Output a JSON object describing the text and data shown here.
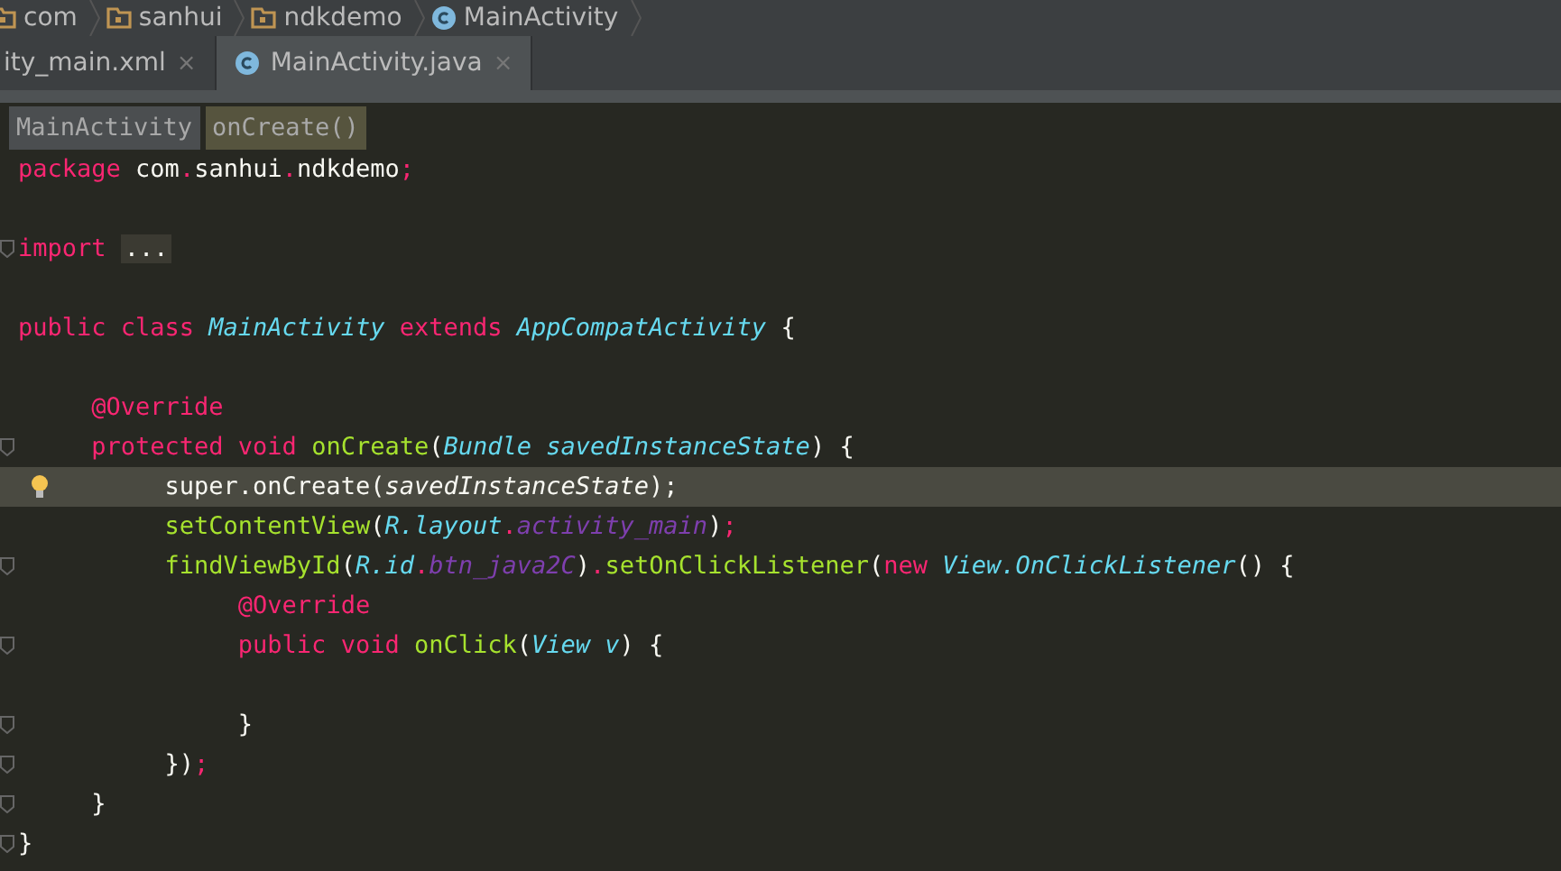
{
  "breadcrumbs": [
    {
      "kind": "folder",
      "label": "com"
    },
    {
      "kind": "folder",
      "label": "sanhui"
    },
    {
      "kind": "folder",
      "label": "ndkdemo"
    },
    {
      "kind": "class",
      "label": "MainActivity"
    }
  ],
  "tabs": [
    {
      "label": "ity_main.xml",
      "kind": "xml",
      "selected": false,
      "close": "×"
    },
    {
      "label": "MainActivity.java",
      "kind": "class",
      "selected": true,
      "close": "×"
    }
  ],
  "structure": [
    {
      "label": "MainActivity",
      "selected": false
    },
    {
      "label": "onCreate()",
      "selected": true
    }
  ],
  "lines": [
    {
      "tokens": [
        {
          "kind": "kw",
          "text": "package"
        },
        {
          "kind": "plain",
          "text": " com"
        },
        {
          "kind": "punct",
          "text": "."
        },
        {
          "kind": "plain",
          "text": "sanhui"
        },
        {
          "kind": "punct",
          "text": "."
        },
        {
          "kind": "plain",
          "text": "ndkdemo"
        },
        {
          "kind": "punct",
          "text": ";"
        }
      ]
    },
    {
      "kind": "blank"
    },
    {
      "fold": true,
      "tokens": [
        {
          "kind": "kw",
          "text": "import "
        },
        {
          "kind": "folded",
          "text": "..."
        }
      ]
    },
    {
      "kind": "blank"
    },
    {
      "tokens": [
        {
          "kind": "kw",
          "text": "public class "
        },
        {
          "kind": "type",
          "text": "MainActivity"
        },
        {
          "kind": "kw",
          "text": " extends "
        },
        {
          "kind": "type",
          "text": "AppCompatActivity"
        },
        {
          "kind": "plain",
          "text": " {"
        }
      ]
    },
    {
      "kind": "blank"
    },
    {
      "tokens": [
        {
          "kind": "annotation",
          "text": "     @Override"
        }
      ]
    },
    {
      "fold": true,
      "tokens": [
        {
          "kind": "kw",
          "text": "     protected void "
        },
        {
          "kind": "method",
          "text": "onCreate"
        },
        {
          "kind": "plain",
          "text": "("
        },
        {
          "kind": "type",
          "text": "Bundle savedInstanceState"
        },
        {
          "kind": "plain",
          "text": ") {"
        }
      ]
    },
    {
      "highlighted": true,
      "bulb": true,
      "tokens": [
        {
          "kind": "plain",
          "text": "          super.onCreate("
        },
        {
          "kind": "param",
          "text": "savedInstanceState"
        },
        {
          "kind": "plain",
          "text": ");"
        }
      ]
    },
    {
      "tokens": [
        {
          "kind": "method",
          "text": "          setContentView"
        },
        {
          "kind": "plain",
          "text": "("
        },
        {
          "kind": "type",
          "text": "R.layout"
        },
        {
          "kind": "punct",
          "text": "."
        },
        {
          "kind": "field",
          "text": "activity_main"
        },
        {
          "kind": "plain",
          "text": ")"
        },
        {
          "kind": "punct",
          "text": ";"
        }
      ]
    },
    {
      "fold": true,
      "tokens": [
        {
          "kind": "method",
          "text": "          findViewById"
        },
        {
          "kind": "plain",
          "text": "("
        },
        {
          "kind": "type",
          "text": "R.id"
        },
        {
          "kind": "punct",
          "text": "."
        },
        {
          "kind": "field",
          "text": "btn_java2C"
        },
        {
          "kind": "plain",
          "text": ")"
        },
        {
          "kind": "punct",
          "text": "."
        },
        {
          "kind": "method",
          "text": "setOnClickListener"
        },
        {
          "kind": "plain",
          "text": "("
        },
        {
          "kind": "kw",
          "text": "new "
        },
        {
          "kind": "type",
          "text": "View.OnClickListener"
        },
        {
          "kind": "plain",
          "text": "() {"
        }
      ]
    },
    {
      "tokens": [
        {
          "kind": "annotation",
          "text": "               @Override"
        }
      ]
    },
    {
      "fold": true,
      "tokens": [
        {
          "kind": "kw",
          "text": "               public void "
        },
        {
          "kind": "method",
          "text": "onClick"
        },
        {
          "kind": "plain",
          "text": "("
        },
        {
          "kind": "type",
          "text": "View v"
        },
        {
          "kind": "plain",
          "text": ") {"
        }
      ]
    },
    {
      "kind": "blank"
    },
    {
      "fold": true,
      "tokens": [
        {
          "kind": "plain",
          "text": "               }"
        }
      ]
    },
    {
      "fold": true,
      "tokens": [
        {
          "kind": "plain",
          "text": "          })"
        },
        {
          "kind": "punct",
          "text": ";"
        }
      ]
    },
    {
      "fold": true,
      "tokens": [
        {
          "kind": "plain",
          "text": "     }"
        }
      ]
    },
    {
      "fold": true,
      "tokens": [
        {
          "kind": "plain",
          "text": "}"
        }
      ]
    }
  ]
}
